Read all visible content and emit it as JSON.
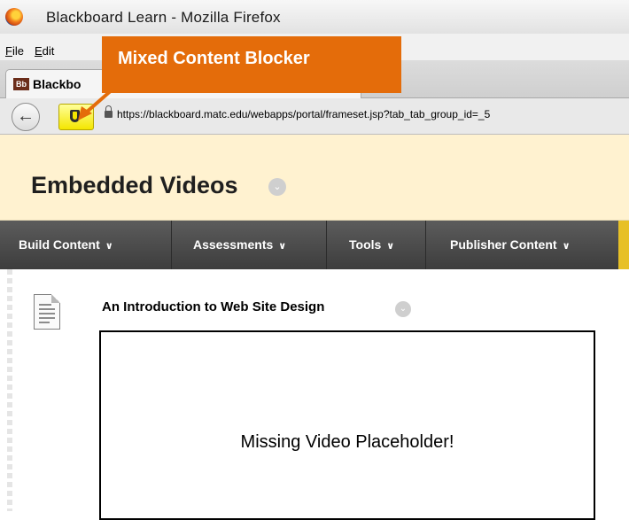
{
  "window": {
    "title": "Blackboard Learn - Mozilla Firefox"
  },
  "menu": {
    "file": "File",
    "file_accel": "F",
    "file_rest": "ile",
    "edit": "Edit",
    "edit_accel": "E",
    "edit_rest": "dit"
  },
  "tab": {
    "icon_label": "Bb",
    "label": "Blackbo"
  },
  "address_bar": {
    "url": "https://blackboard.matc.edu/webapps/portal/frameset.jsp?tab_tab_group_id=_5"
  },
  "annotation": {
    "label": "Mixed Content Blocker",
    "color": "#e46c0a"
  },
  "page": {
    "title": "Embedded Videos",
    "actions": [
      {
        "label": "Build Content"
      },
      {
        "label": "Assessments"
      },
      {
        "label": "Tools"
      },
      {
        "label": "Publisher Content"
      }
    ],
    "content_item": {
      "title": "An Introduction to Web Site Design",
      "video_placeholder": "Missing Video Placeholder!"
    }
  },
  "icons": {
    "browser": "firefox-icon",
    "back": "back-arrow-icon",
    "shield": "mixed-content-shield-icon",
    "lock": "lock-icon",
    "document": "document-icon",
    "chevron": "chevron-down-icon"
  },
  "colors": {
    "header_bg": "#fff2d0",
    "actionbar_bg": "#4a4a4a",
    "shield_bg": "#f4e600"
  }
}
